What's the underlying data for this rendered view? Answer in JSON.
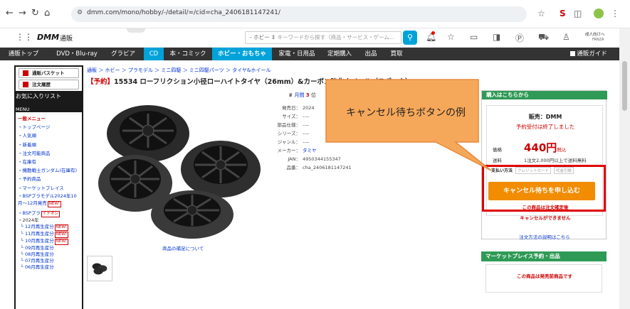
{
  "browser": {
    "url": "dmm.com/mono/hobby/-/detail/=/cid=cha_2406181147241/"
  },
  "header": {
    "logo": "DMM",
    "logo_sub": "通販",
    "search_scope": "- ホビー ⇕",
    "search_placeholder": "キーワードから探す（商品・サービス・ゲーム…",
    "adult_link": "成人向けへ",
    "adult_sub": "FANZA"
  },
  "nav": {
    "items": [
      "通販トップ",
      "DVD・Blu-ray",
      "グラビア",
      "CD",
      "本・コミック",
      "ホビー・おもちゃ",
      "家電・日用品",
      "定期購入",
      "出品",
      "買取"
    ],
    "guide": "通販ガイド"
  },
  "sidebar": {
    "basket": "通販バスケット",
    "history": "注文履歴",
    "favorites": "お気に入りリスト",
    "menu_title": "MENU",
    "list_head": "一般メニュー",
    "items": [
      "・トップページ",
      "・人気順",
      "・新着順",
      "・注文可能商品",
      "・在庫有",
      "・機動戦士ガンダム(在庫有)",
      "・予約商品",
      "・マーケットプレイス"
    ],
    "bsp1": "・BSPプラモデル2024年10月〜12月発売",
    "bsp2": "・BSPプラ",
    "bsp2_tag": "イチオシ",
    "year": "・2024年",
    "months": [
      "└ 12月再生産分",
      "└ 11月再生産分",
      "└ 10月再生産分",
      "└ 09月再生産分",
      "└ 08月再生産分",
      "└ 07月再生産分",
      "└ 06月再生産分"
    ],
    "new_label": "NEW!"
  },
  "product": {
    "breadcrumb": "通販 ＞ ホビー ＞ プラモデル ＞ ミニ四駆 ＞ ミニ四駆パーツ ＞ タイヤ&ホイール",
    "title_tag": "【予約】",
    "title": "15534 ローフリクション小径ローハイトタイヤ（26mm）&カーボン強化ホイール（スポーク）",
    "image_caption": "商品の補足について",
    "rank_label": "月間",
    "rank_value": "3",
    "rank_suffix": "位",
    "details": [
      {
        "k": "発売日：",
        "v": "2024"
      },
      {
        "k": "サイズ：",
        "v": "----"
      },
      {
        "k": "部品仕様：",
        "v": "----"
      },
      {
        "k": "シリーズ：",
        "v": "----"
      },
      {
        "k": "ジャンル：",
        "v": "----"
      },
      {
        "k": "メーカー：",
        "v": "タミヤ"
      },
      {
        "k": "JAN：",
        "v": "4950344155347"
      },
      {
        "k": "品番：",
        "v": "cha_2406181147241"
      }
    ]
  },
  "purchase": {
    "heading": "購入はこちらから",
    "seller": "販売：DMM",
    "closed": "予約受付は終了しました",
    "price_label": "価格",
    "price": "440円",
    "price_tax": "税込",
    "shipping_label": "送料",
    "shipping": "1注文2,000円以上で送料無料",
    "payment_label": "支払い方法",
    "payment_methods": [
      "クレジットカード",
      "代金引換"
    ],
    "cancel_button": "キャンセル待ちを申し込む",
    "note_cancel_only": "この商品は注文確定後",
    "note_no_cancel": "キャンセルができません",
    "order_method_link": "注文方法の説明はこちら"
  },
  "market": {
    "heading": "マーケットプレイス予約・出品",
    "message": "この商品は発売前商品です"
  },
  "callout": {
    "text": "キャンセル待ちボタンの例"
  },
  "colors": {
    "accent_orange": "#f28c00",
    "highlight_red": "#e00000",
    "callout_fill": "#f6a85a",
    "green": "#2e9a55"
  }
}
